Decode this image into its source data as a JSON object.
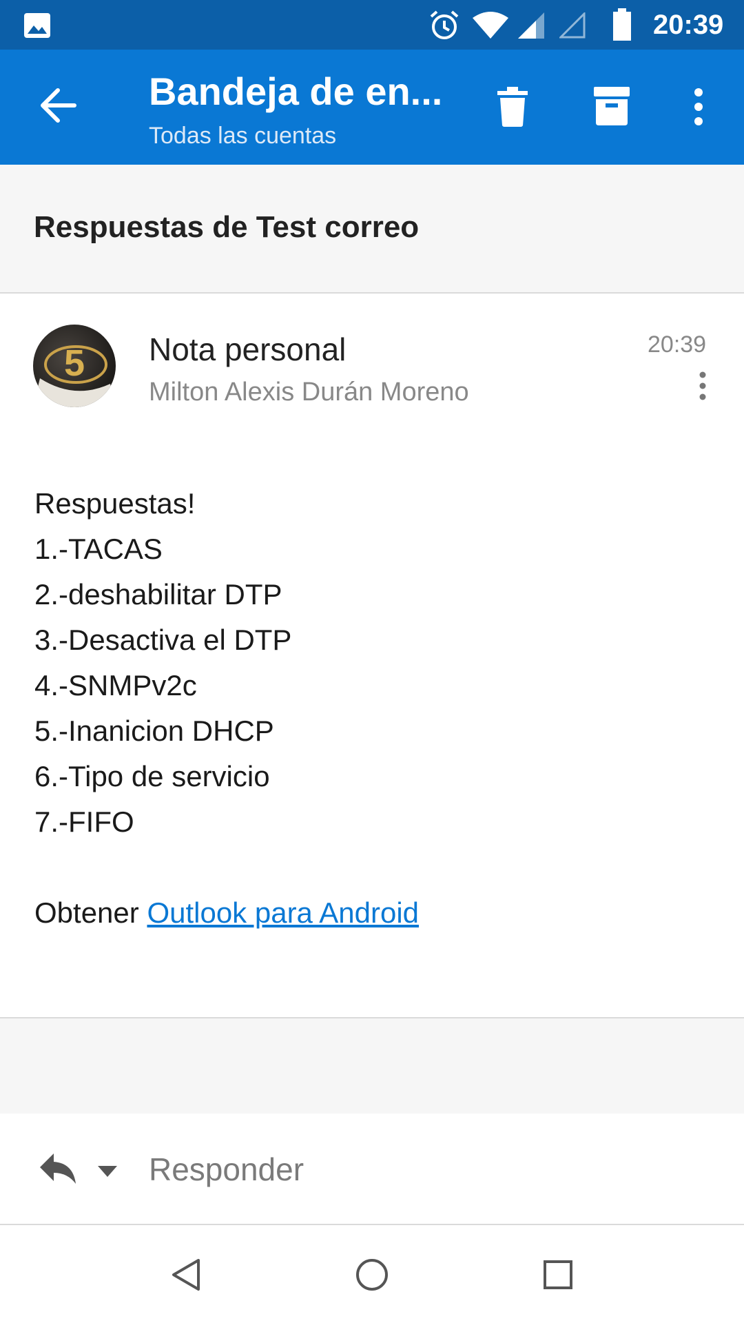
{
  "status_bar": {
    "time": "20:39",
    "icons": [
      "image-icon",
      "alarm-icon",
      "wifi-icon",
      "signal-icon",
      "signal-empty-icon",
      "battery-icon"
    ]
  },
  "app_bar": {
    "title": "Bandeja de en...",
    "subtitle": "Todas las cuentas",
    "color": "#0a78d4",
    "actions": [
      "back-arrow-icon",
      "delete-icon",
      "archive-icon",
      "more-vert-icon"
    ]
  },
  "thread": {
    "subject": "Respuestas de Test correo"
  },
  "message": {
    "sender": "Nota personal",
    "account": "Milton Alexis Durán Moreno",
    "time": "20:39",
    "avatar_text": "5",
    "body": {
      "greeting": "Respuestas!",
      "lines": [
        "1.-TACAS",
        "2.-deshabilitar DTP",
        "3.-Desactiva el DTP",
        "4.-SNMPv2c",
        "5.-Inanicion DHCP",
        "6.-Tipo de servicio",
        "7.-FIFO"
      ],
      "footer_prefix": "Obtener ",
      "footer_link": "Outlook para Android"
    }
  },
  "reply": {
    "placeholder": "Responder"
  },
  "nav": [
    "back-triangle-icon",
    "home-circle-icon",
    "recents-square-icon"
  ]
}
